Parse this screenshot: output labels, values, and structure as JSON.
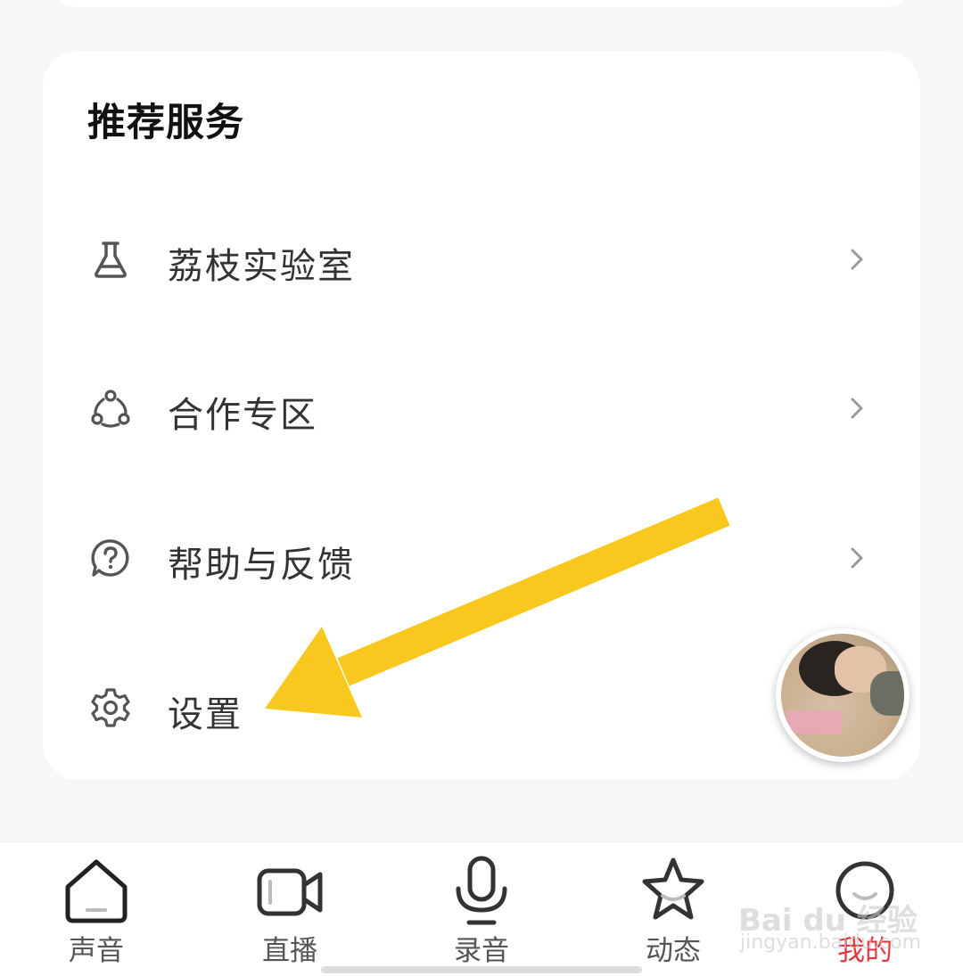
{
  "section": {
    "title": "推荐服务"
  },
  "services": [
    {
      "label": "荔枝实验室",
      "icon": "flask-icon"
    },
    {
      "label": "合作专区",
      "icon": "cooperation-nodes-icon"
    },
    {
      "label": "帮助与反馈",
      "icon": "help-question-icon"
    },
    {
      "label": "设置",
      "icon": "gear-icon"
    }
  ],
  "annotation": {
    "arrow_color": "#f9c81e",
    "target": "设置"
  },
  "bottom_nav": [
    {
      "label": "声音",
      "icon": "home-icon"
    },
    {
      "label": "直播",
      "icon": "video-camera-icon"
    },
    {
      "label": "录音",
      "icon": "microphone-icon"
    },
    {
      "label": "动态",
      "icon": "star-icon"
    },
    {
      "label": "我的",
      "icon": "profile-icon",
      "active": true
    }
  ],
  "colors": {
    "active": "#e0393e",
    "text": "#333333",
    "background": "#f7f7f7"
  },
  "watermark": {
    "brand": "Bai du 经验",
    "url": "jingyan.baidu.com"
  }
}
